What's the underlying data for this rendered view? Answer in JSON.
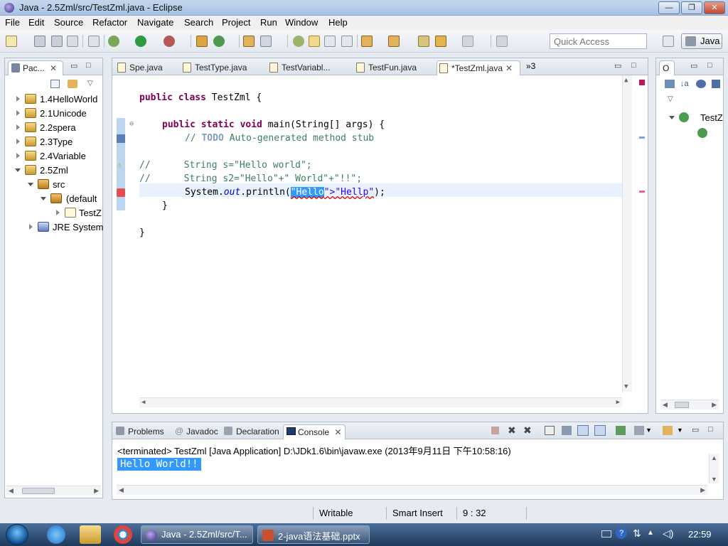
{
  "window": {
    "title": "Java - 2.5Zml/src/TestZml.java - Eclipse"
  },
  "menu": [
    "File",
    "Edit",
    "Source",
    "Refactor",
    "Navigate",
    "Search",
    "Project",
    "Run",
    "Window",
    "Help"
  ],
  "toolbar": {
    "quick_access_placeholder": "Quick Access",
    "perspective": "Java"
  },
  "package_explorer": {
    "tab_label": "Pac...",
    "items": [
      {
        "label": "1.4HelloWorld",
        "type": "project"
      },
      {
        "label": "2.1Unicode",
        "type": "project"
      },
      {
        "label": "2.2spera",
        "type": "project"
      },
      {
        "label": "2.3Type",
        "type": "project"
      },
      {
        "label": "2.4Variable",
        "type": "project"
      },
      {
        "label": "2.5Zml",
        "type": "project"
      },
      {
        "label": "src",
        "type": "folder"
      },
      {
        "label": "(default",
        "type": "package"
      },
      {
        "label": "TestZ",
        "type": "file"
      },
      {
        "label": "JRE System",
        "type": "library"
      }
    ]
  },
  "editor": {
    "tabs": [
      "Spe.java",
      "TestType.java",
      "TestVariabl...",
      "TestFun.java",
      "*TestZml.java"
    ],
    "overflow": "»3",
    "code": {
      "l1_kw": "public class",
      "l1_rest": " TestZml {",
      "l2_kw": "public static void",
      "l2_rest": " main(String[] args) {",
      "l3_pre": "// ",
      "l3_todo": "TODO",
      "l3_rest": " Auto-generated method stub",
      "l4": "//      String s=\"Hello world\";",
      "l5": "//      String s2=\"Hello\"+\" World\"+\"!!\";",
      "l6_pre": "System.",
      "l6_out": "out",
      "l6_mid": ".println(",
      "l6_sel": "\"Hello",
      "l6_str": "\">\"Hellp\"",
      "l6_end": ");",
      "l7": "}",
      "l8": "}"
    }
  },
  "outline": {
    "tab_label": "O",
    "item": "TestZ"
  },
  "console": {
    "tabs": [
      "Problems",
      "Javadoc",
      "Declaration",
      "Console"
    ],
    "header": "<terminated> TestZml [Java Application] D:\\JDk1.6\\bin\\javaw.exe (2013年9月11日 下午10:58:16)",
    "output": "Hello World!!"
  },
  "status": {
    "mode": "Writable",
    "insert": "Smart Insert",
    "position": "9 : 32"
  },
  "taskbar": {
    "windows": [
      "Java - 2.5Zml/src/T...",
      "2-java语法基础.pptx"
    ],
    "clock": "22:59"
  }
}
